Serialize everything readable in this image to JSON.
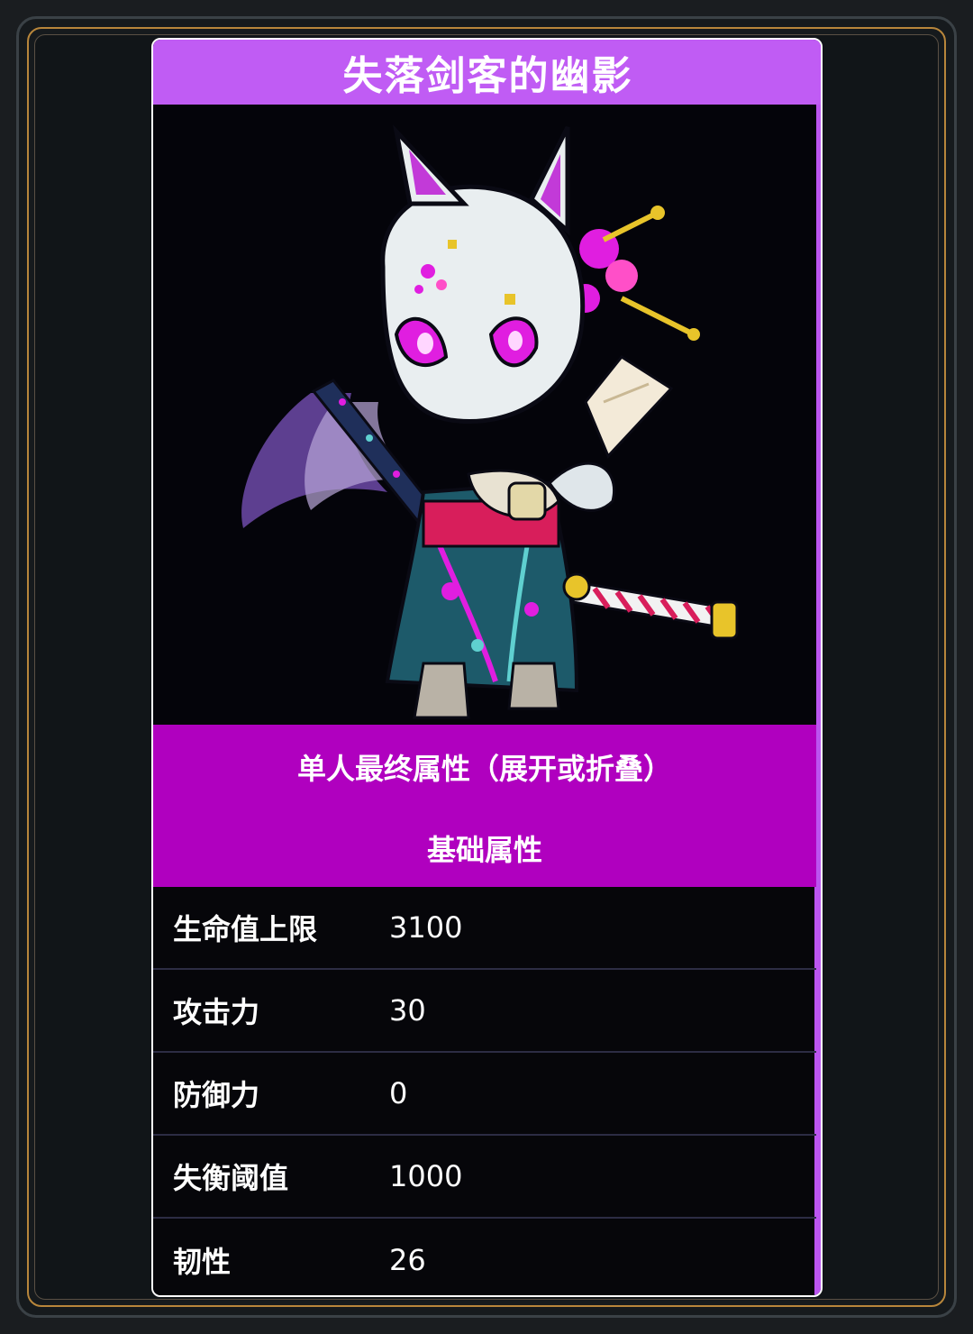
{
  "card": {
    "title": "失落剑客的幽影",
    "attributes_toggle": "单人最终属性（展开或折叠）",
    "section_title": "基础属性",
    "stats": [
      {
        "label": "生命值上限",
        "value": "3100"
      },
      {
        "label": "攻击力",
        "value": "30"
      },
      {
        "label": "防御力",
        "value": "0"
      },
      {
        "label": "失衡阈值",
        "value": "1000"
      },
      {
        "label": "韧性",
        "value": "26"
      }
    ]
  },
  "colors": {
    "title_bar": "#c05cf4",
    "header_band": "#b000bf",
    "card_background": "#06060a",
    "frame_gold": "#b8863b",
    "accent_magenta": "#e01ee0"
  },
  "icons": {
    "portrait": "masked-fox-swordsman-portrait"
  }
}
